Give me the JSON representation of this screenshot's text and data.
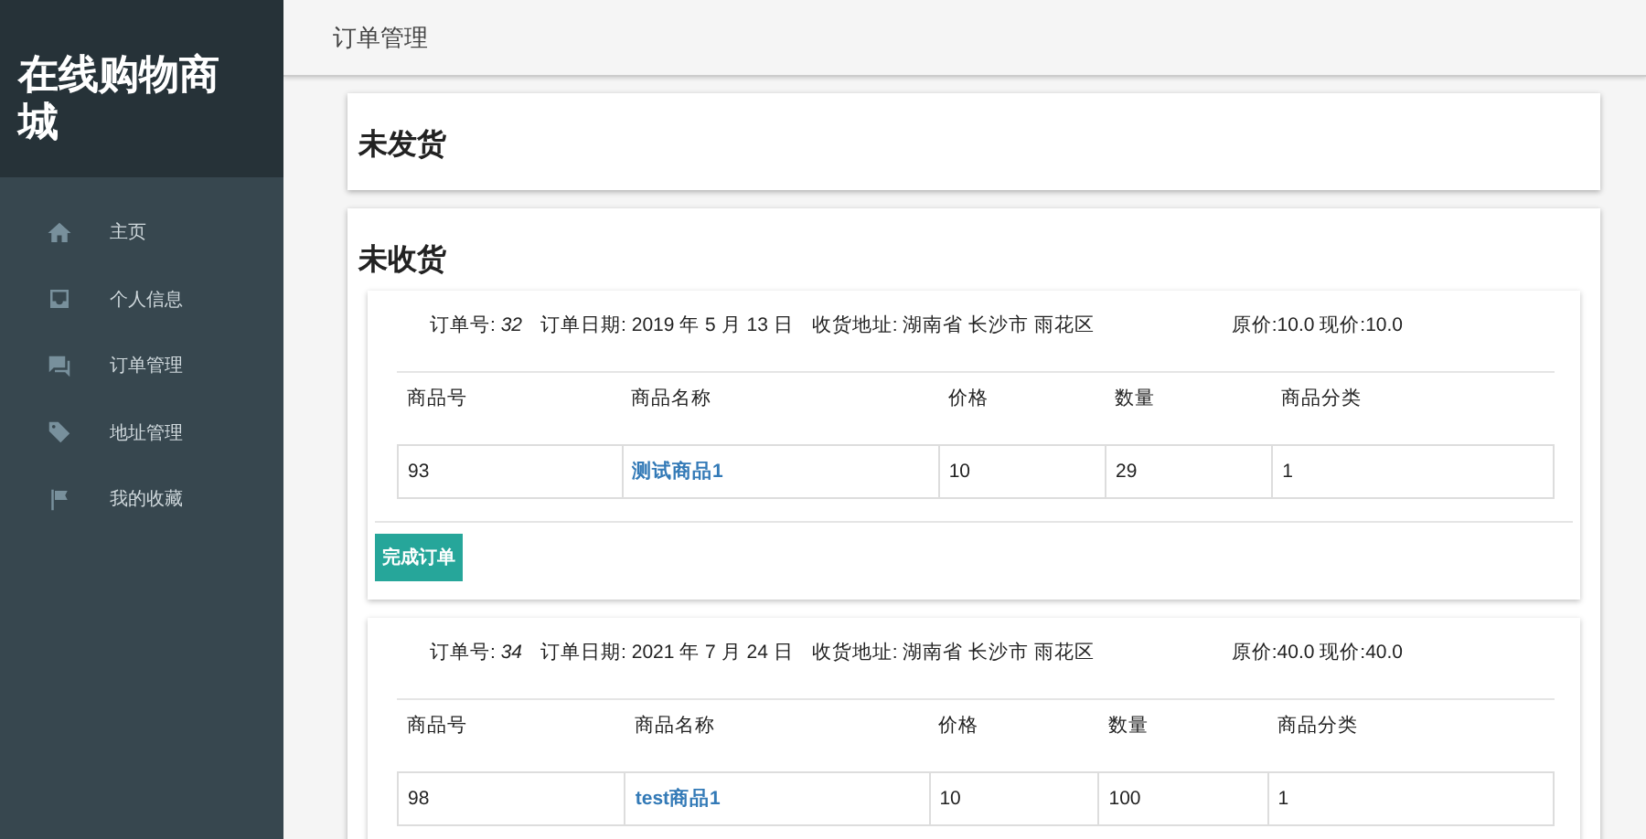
{
  "sidebar": {
    "title": "在线购物商城",
    "items": [
      {
        "label": "主页"
      },
      {
        "label": "个人信息"
      },
      {
        "label": "订单管理"
      },
      {
        "label": "地址管理"
      },
      {
        "label": "我的收藏"
      }
    ]
  },
  "header": {
    "title": "订单管理"
  },
  "sections": [
    {
      "title": "未发货"
    },
    {
      "title": "未收货",
      "orders": [
        {
          "number_label": "订单号:",
          "number": "32",
          "date": "订单日期: 2019 年 5 月 13 日",
          "address": "收货地址: 湖南省 长沙市 雨花区",
          "price": "原价:10.0 现价:10.0",
          "columns": [
            "商品号",
            "商品名称",
            "价格",
            "数量",
            "商品分类"
          ],
          "rows": [
            [
              "93",
              "测试商品1",
              "10",
              "29",
              "1"
            ]
          ],
          "button": "完成订单"
        },
        {
          "number_label": "订单号:",
          "number": "34",
          "date": "订单日期: 2021 年 7 月 24 日",
          "address": "收货地址: 湖南省 长沙市 雨花区",
          "price": "原价:40.0 现价:40.0",
          "columns": [
            "商品号",
            "商品名称",
            "价格",
            "数量",
            "商品分类"
          ],
          "rows": [
            [
              "98",
              "test商品1",
              "10",
              "100",
              "1"
            ]
          ]
        }
      ]
    }
  ]
}
